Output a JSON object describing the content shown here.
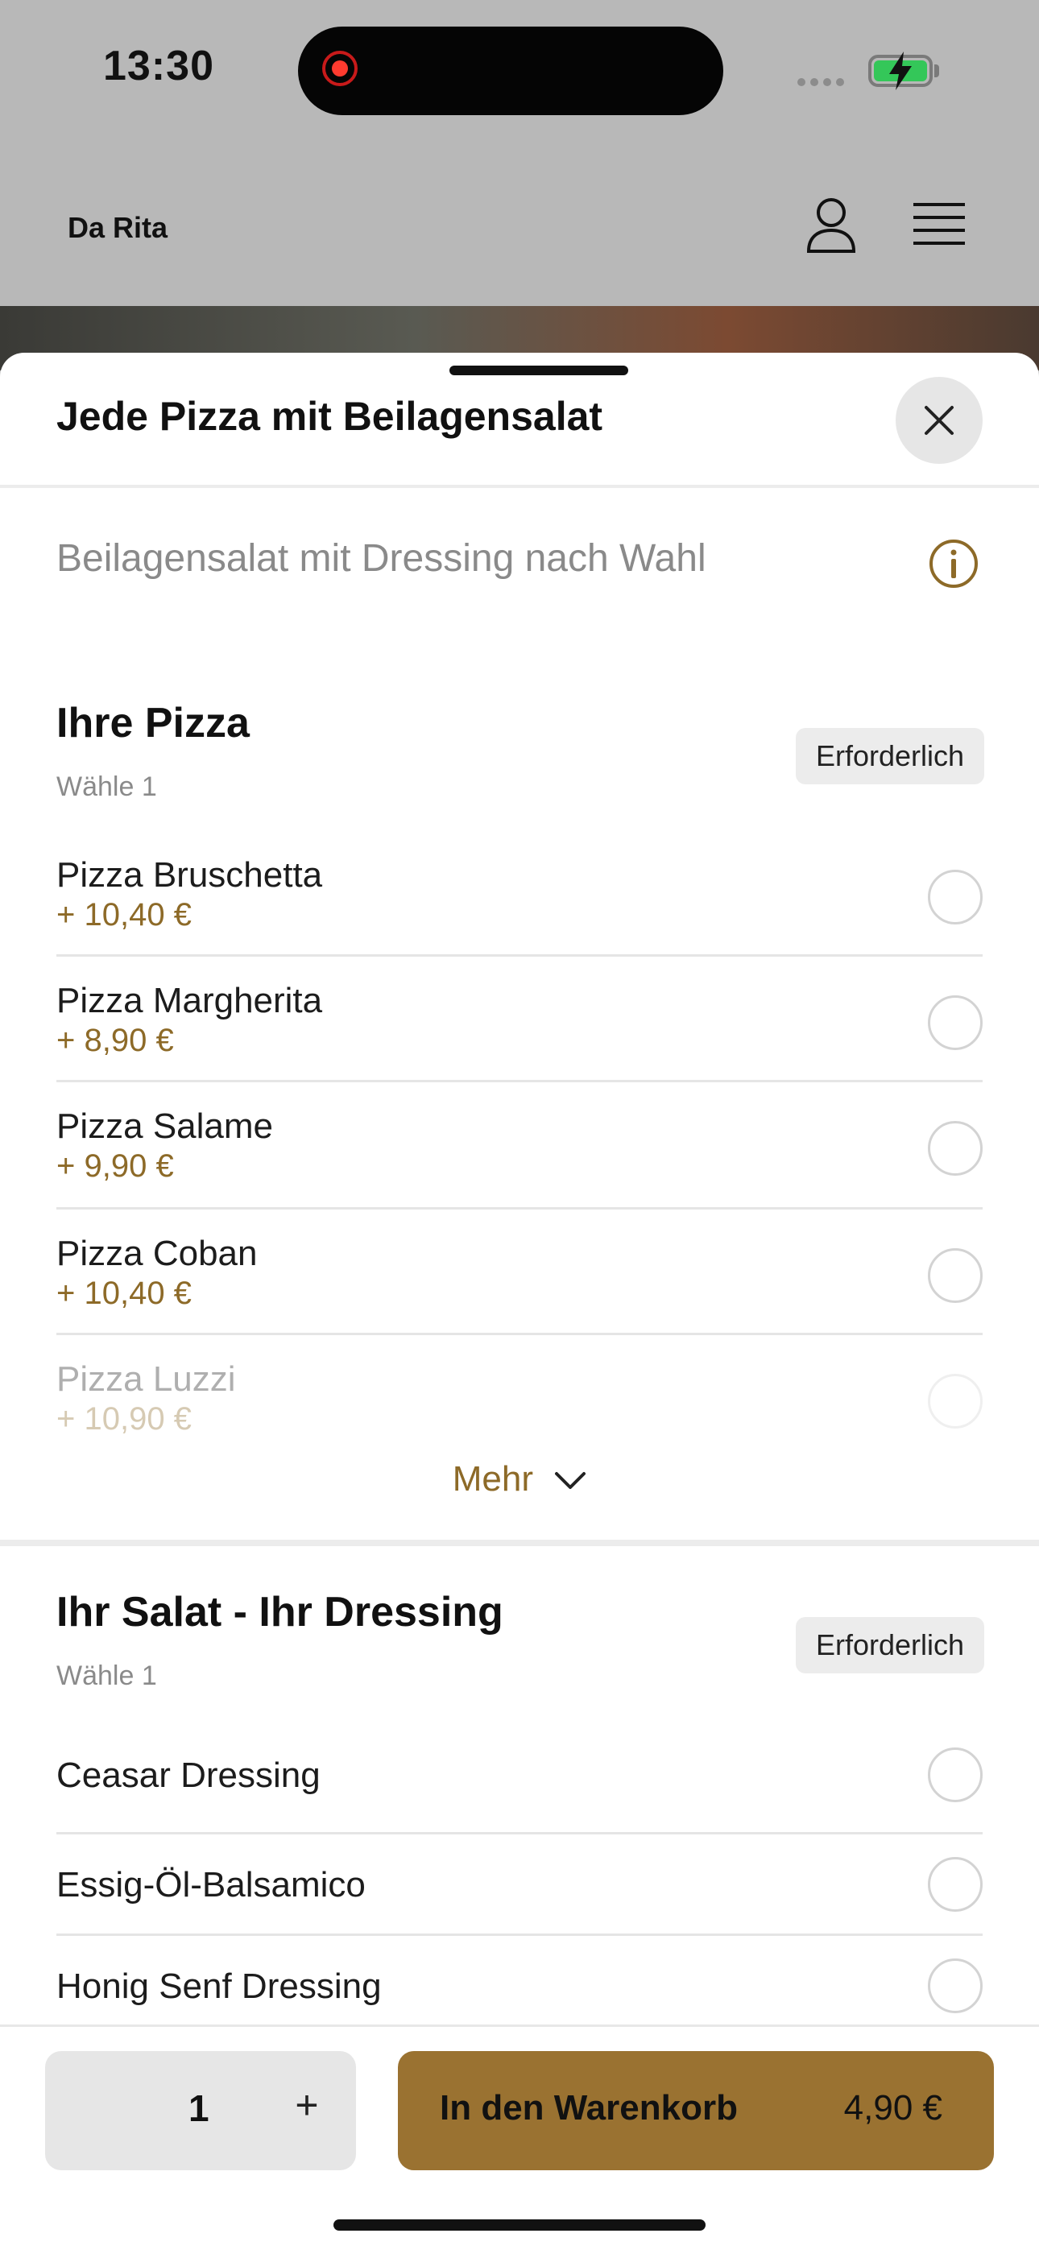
{
  "status_bar": {
    "time": "13:30",
    "battery_color": "#34c759"
  },
  "app_header": {
    "brand": "Da Rita",
    "icons": [
      "user-icon",
      "menu-icon"
    ]
  },
  "sheet": {
    "title": "Jede Pizza mit Beilagensalat",
    "description": "Beilagensalat mit Dressing nach Wahl",
    "icons": [
      "close-icon",
      "info-icon"
    ]
  },
  "pizza_section": {
    "title": "Ihre Pizza",
    "choose_label": "Wähle 1",
    "badge": "Erforderlich",
    "options": [
      {
        "name": "Pizza Bruschetta",
        "price": "+ 10,40 €"
      },
      {
        "name": "Pizza Margherita",
        "price": "+ 8,90 €"
      },
      {
        "name": "Pizza Salame",
        "price": "+ 9,90 €"
      },
      {
        "name": "Pizza Coban",
        "price": "+ 10,40 €"
      },
      {
        "name": "Pizza Luzzi",
        "price": "+ 10,90 €"
      }
    ],
    "more_label": "Mehr"
  },
  "salad_section": {
    "title": "Ihr Salat - Ihr Dressing",
    "choose_label": "Wähle 1",
    "badge": "Erforderlich",
    "options": [
      {
        "name": "Ceasar Dressing"
      },
      {
        "name": "Essig-Öl-Balsamico"
      },
      {
        "name": "Honig Senf Dressing"
      }
    ]
  },
  "bottom_bar": {
    "quantity": "1",
    "plus_label": "+",
    "cart_label": "In den Warenkorb",
    "total": "4,90 €",
    "accent_color": "#9a7231"
  }
}
